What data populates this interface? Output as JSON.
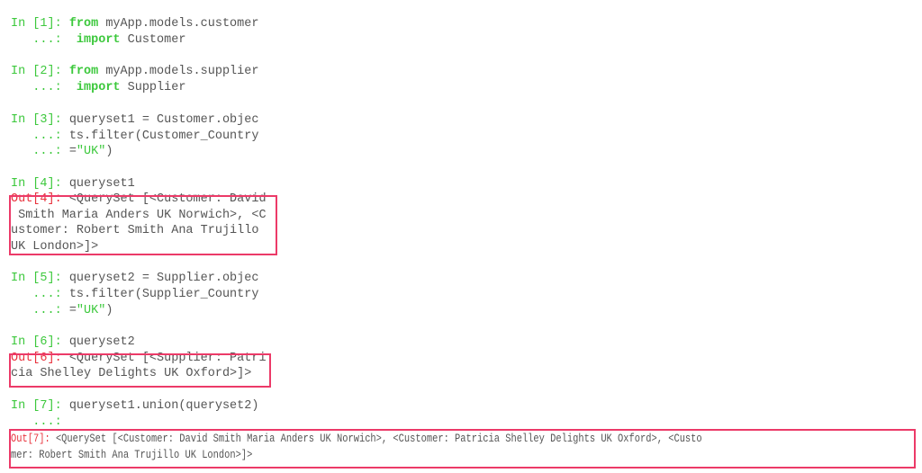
{
  "accent_colors": {
    "prompt": "#3cc83c",
    "output_prompt": "#e8323c",
    "highlight_box": "#ec3a68",
    "text": "#555555"
  },
  "cells": [
    {
      "lines": [
        [
          {
            "t": "In [1]: ",
            "c": "prompt"
          },
          {
            "t": "from",
            "c": "kw"
          },
          {
            "t": " myApp.models.customer",
            "c": "txt"
          }
        ],
        [
          {
            "t": "   ...: ",
            "c": "prompt"
          },
          {
            "t": " import",
            "c": "kw"
          },
          {
            "t": " Customer",
            "c": "txt"
          }
        ]
      ]
    },
    {
      "lines": [
        [
          {
            "t": "In [2]: ",
            "c": "prompt"
          },
          {
            "t": "from",
            "c": "kw"
          },
          {
            "t": " myApp.models.supplier",
            "c": "txt"
          }
        ],
        [
          {
            "t": "   ...: ",
            "c": "prompt"
          },
          {
            "t": " import",
            "c": "kw"
          },
          {
            "t": " Supplier",
            "c": "txt"
          }
        ]
      ]
    },
    {
      "lines": [
        [
          {
            "t": "In [3]: ",
            "c": "prompt"
          },
          {
            "t": "queryset1 = Customer.objec",
            "c": "txt"
          }
        ],
        [
          {
            "t": "   ...: ",
            "c": "prompt"
          },
          {
            "t": "ts.filter(Customer_Country",
            "c": "txt"
          }
        ],
        [
          {
            "t": "   ...: ",
            "c": "prompt"
          },
          {
            "t": "=",
            "c": "txt"
          },
          {
            "t": "\"UK\"",
            "c": "str"
          },
          {
            "t": ")",
            "c": "txt"
          }
        ]
      ]
    },
    {
      "lines": [
        [
          {
            "t": "In [4]: ",
            "c": "prompt"
          },
          {
            "t": "queryset1",
            "c": "txt"
          }
        ]
      ]
    },
    {
      "output": true,
      "lines": [
        [
          {
            "t": "Out[4]: ",
            "c": "outp"
          },
          {
            "t": "<QuerySet [<Customer: David",
            "c": "txt"
          }
        ],
        [
          {
            "t": " Smith Maria Anders UK Norwich>, <C",
            "c": "txt"
          }
        ],
        [
          {
            "t": "ustomer: Robert Smith Ana Trujillo",
            "c": "txt"
          }
        ],
        [
          {
            "t": "UK London>]>",
            "c": "txt"
          }
        ]
      ]
    },
    {
      "lines": [
        [
          {
            "t": "In [5]: ",
            "c": "prompt"
          },
          {
            "t": "queryset2 = Supplier.objec",
            "c": "txt"
          }
        ],
        [
          {
            "t": "   ...: ",
            "c": "prompt"
          },
          {
            "t": "ts.filter(Supplier_Country",
            "c": "txt"
          }
        ],
        [
          {
            "t": "   ...: ",
            "c": "prompt"
          },
          {
            "t": "=",
            "c": "txt"
          },
          {
            "t": "\"UK\"",
            "c": "str"
          },
          {
            "t": ")",
            "c": "txt"
          }
        ]
      ]
    },
    {
      "lines": [
        [
          {
            "t": "In [6]: ",
            "c": "prompt"
          },
          {
            "t": "queryset2",
            "c": "txt"
          }
        ]
      ]
    },
    {
      "output": true,
      "lines": [
        [
          {
            "t": "Out[6]: ",
            "c": "outp"
          },
          {
            "t": "<QuerySet [<Supplier: Patri",
            "c": "txt"
          }
        ],
        [
          {
            "t": "cia Shelley Delights UK Oxford>]>",
            "c": "txt"
          }
        ]
      ]
    },
    {
      "lines": [
        [
          {
            "t": "In [7]: ",
            "c": "prompt"
          },
          {
            "t": "queryset1.union(queryset2)",
            "c": "txt"
          }
        ],
        [
          {
            "t": "   ...: ",
            "c": "prompt"
          }
        ]
      ]
    },
    {
      "output": true,
      "lines": [
        [
          {
            "t": "Out[7]: ",
            "c": "outp"
          },
          {
            "t": "<QuerySet [<Customer: David Smith Maria Anders UK Norwich>, <Customer: Patricia Shelley Delights UK Oxford>, <Custo",
            "c": "txt"
          }
        ],
        [
          {
            "t": "mer: Robert Smith Ana Trujillo UK London>]>",
            "c": "txt"
          }
        ]
      ]
    }
  ]
}
